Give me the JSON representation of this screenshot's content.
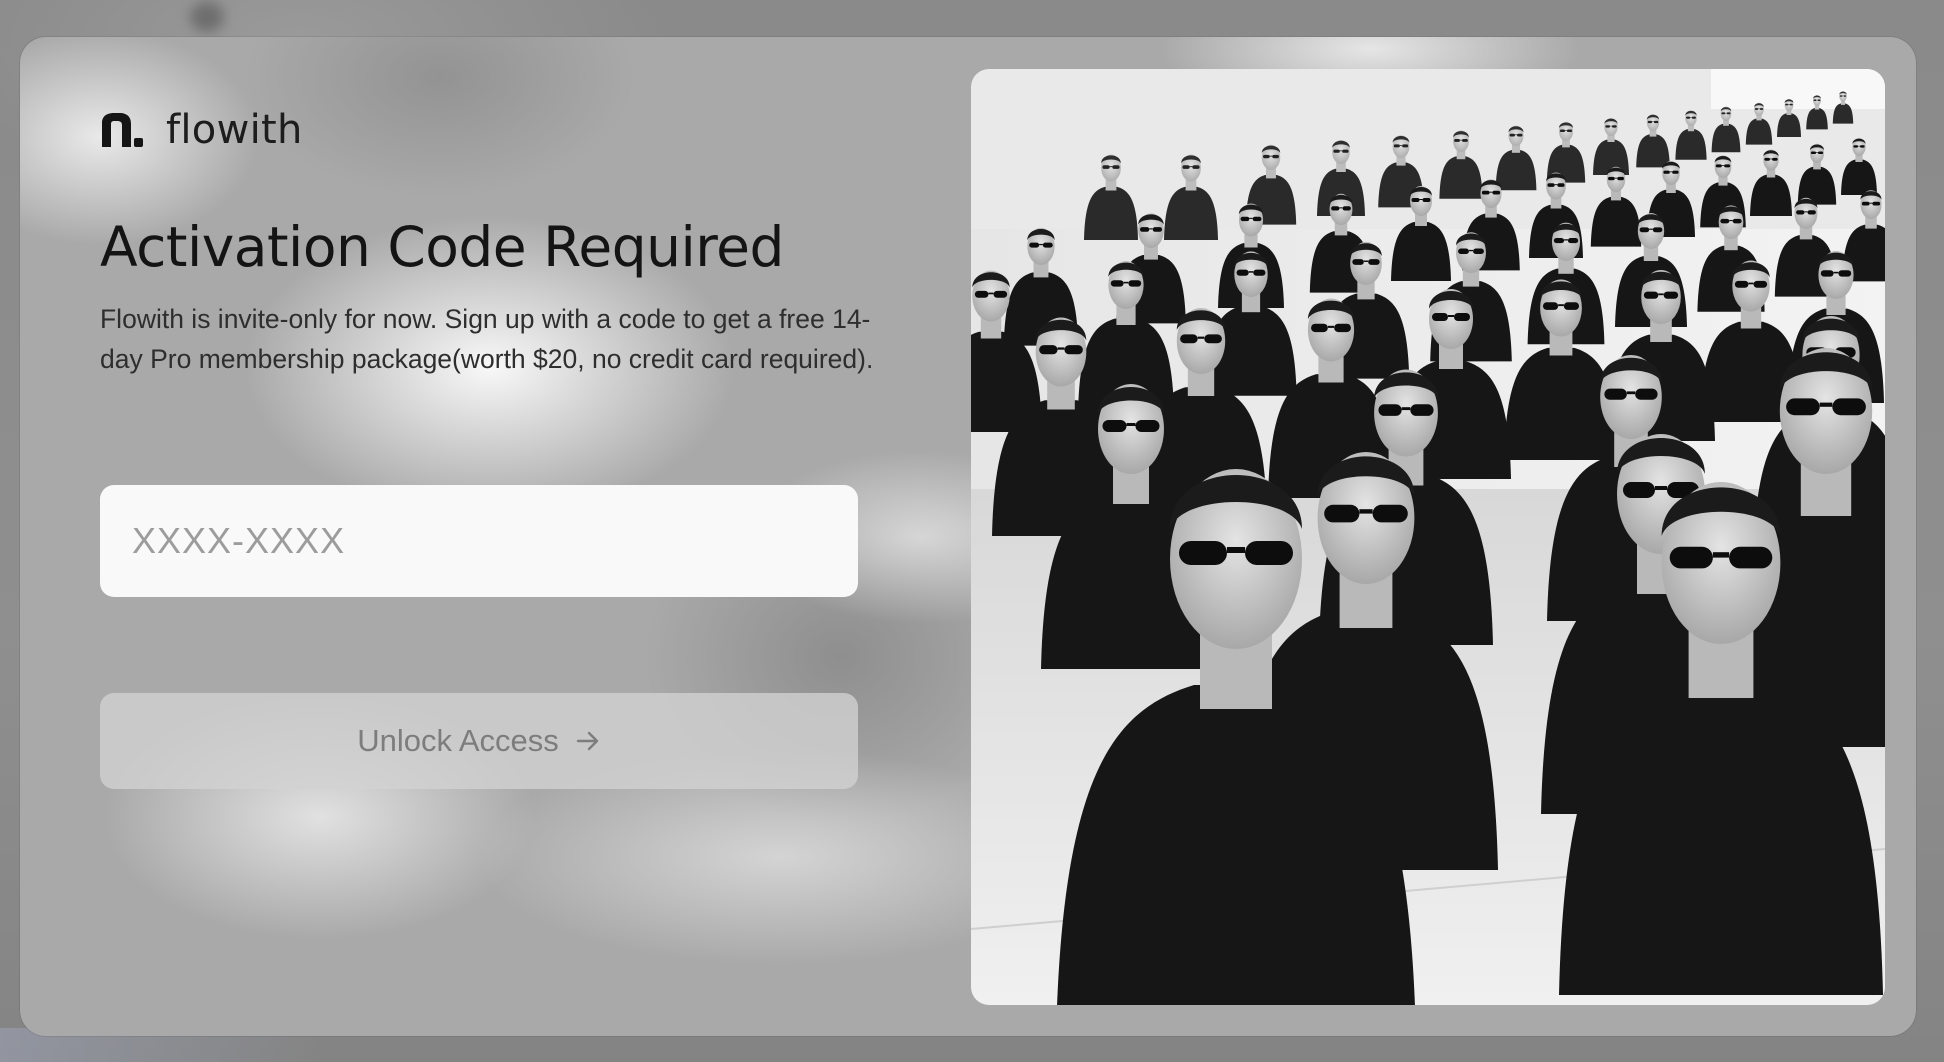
{
  "brand": {
    "name": "flowith",
    "logo_icon": "flowith-logo-icon"
  },
  "dialog": {
    "title": "Activation Code Required",
    "description": "Flowith is invite-only for now. Sign up with a code to get a free 14-day Pro membership package(worth $20, no credit card required).",
    "code_input": {
      "value": "",
      "placeholder": "XXXX-XXXX"
    },
    "submit": {
      "label": "Unlock Access",
      "icon": "arrow-right-icon"
    }
  },
  "image": {
    "subject": "rows of people in black suits and sunglasses",
    "style": "black-and-white"
  },
  "colors": {
    "text_primary": "#141414",
    "input_bg": "#f9f9f9",
    "button_bg": "#d2d2d2",
    "button_text": "#7d7d7d"
  }
}
